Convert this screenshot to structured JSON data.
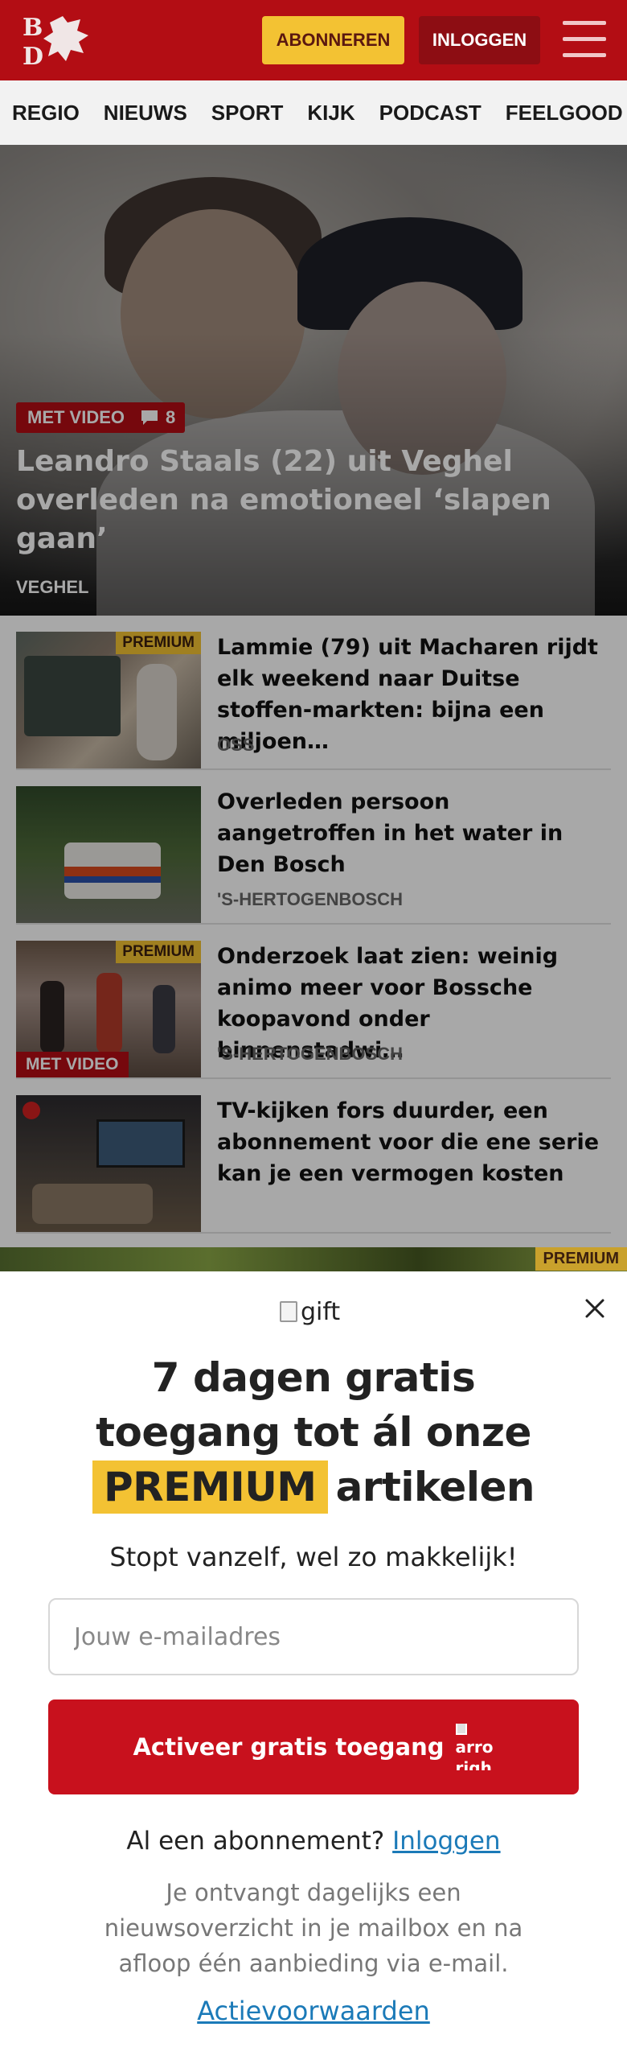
{
  "header": {
    "logo_alt": "BD",
    "subscribe_label": "ABONNEREN",
    "login_label": "INLOGGEN",
    "menu_icon": "hamburger-icon",
    "brand_color": "#b30d14",
    "accent_color": "#f3c233"
  },
  "nav": {
    "items": [
      {
        "label": "REGIO"
      },
      {
        "label": "NIEUWS"
      },
      {
        "label": "SPORT"
      },
      {
        "label": "KIJK"
      },
      {
        "label": "PODCAST"
      },
      {
        "label": "FEELGOOD"
      }
    ]
  },
  "hero": {
    "video_badge": "MET VIDEO",
    "comment_count": "8",
    "title": "Leandro Staals (22) uit Veghel overleden na emotioneel ‘slapen gaan’",
    "location": "VEGHEL"
  },
  "articles": [
    {
      "title": "Lammie (79) uit Macharen rijdt elk weekend naar Duitse stoffen-markten: bijna een miljoen…",
      "location": "OSS",
      "premium": "PREMIUM",
      "video": ""
    },
    {
      "title": "Overleden persoon aangetroffen in het water in Den Bosch",
      "location": "'S-HERTOGENBOSCH",
      "premium": "",
      "video": ""
    },
    {
      "title": "Onderzoek laat zien: weinig animo meer voor Bossche koopavond onder binnenstadwi…",
      "location": "'S-HERTOGENBOSCH",
      "premium": "PREMIUM",
      "video": "MET VIDEO"
    },
    {
      "title": "TV-kijken fors duurder, een abonnement voor die ene serie kan je een vermogen kosten",
      "location": "",
      "premium": "",
      "video": ""
    }
  ],
  "strip_premium": "PREMIUM",
  "modal": {
    "gift_alt": "gift",
    "headline_line1": "7 dagen gratis",
    "headline_line2": "toegang tot ál onze",
    "headline_premium": "PREMIUM",
    "headline_rest": "artikelen",
    "subline": "Stopt vanzelf, wel zo makkelijk!",
    "email_placeholder": "Jouw e-mailadres",
    "email_value": "",
    "cta_label": "Activeer gratis toegang",
    "cta_icon_alt_line1": "arro",
    "cta_icon_alt_line2": "righ",
    "login_prompt": "Al een abonnement?",
    "login_link": "Inloggen",
    "disclaimer": "Je ontvangt dagelijks een nieuwsoverzicht in je mailbox en na afloop één aanbieding via e-mail.",
    "terms_link": "Actievoorwaarden"
  }
}
